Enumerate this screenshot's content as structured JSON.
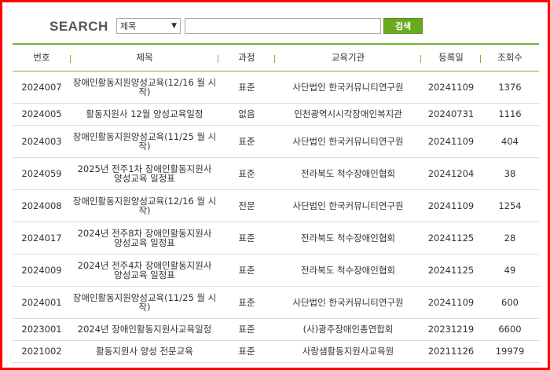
{
  "search": {
    "title": "SEARCH",
    "select_value": "제목",
    "input_value": "",
    "button_label": "검색"
  },
  "table": {
    "headers": [
      "번호",
      "제목",
      "과정",
      "교육기관",
      "등록일",
      "조회수"
    ],
    "rows": [
      {
        "no": "2024007",
        "title": "장애인활동지원양성교육(12/16 월 시작)",
        "course": "표준",
        "org": "사단법인 한국커뮤니티연구원",
        "date": "20241109",
        "views": "1376"
      },
      {
        "no": "2024005",
        "title": "활동지원사 12월 양성교육일정",
        "course": "없음",
        "org": "인천광역시시각장애인복지관",
        "date": "20240731",
        "views": "1116"
      },
      {
        "no": "2024003",
        "title": "장애인활동지원양성교육(11/25 월 시작)",
        "course": "표준",
        "org": "사단법인 한국커뮤니티연구원",
        "date": "20241109",
        "views": "404"
      },
      {
        "no": "2024059",
        "title": "2025년 전주1차 장애인활동지원사 양성교육 일정표",
        "course": "표준",
        "org": "전라북도 척수장애인협회",
        "date": "20241204",
        "views": "38"
      },
      {
        "no": "2024008",
        "title": "장애인활동지원양성교육(12/16 월 시작)",
        "course": "전문",
        "org": "사단법인 한국커뮤니티연구원",
        "date": "20241109",
        "views": "1254"
      },
      {
        "no": "2024017",
        "title": "2024년 전주8차 장애인활동지원사 양성교육 일정표",
        "course": "표준",
        "org": "전라북도 척수장애인협회",
        "date": "20241125",
        "views": "28"
      },
      {
        "no": "2024009",
        "title": "2024년 전주4차 장애인활동지원사 양성교육 일정표",
        "course": "표준",
        "org": "전라북도 척수장애인협회",
        "date": "20241125",
        "views": "49"
      },
      {
        "no": "2024001",
        "title": "장애인활동지원양성교육(11/25 월 시작)",
        "course": "표준",
        "org": "사단법인 한국커뮤니티연구원",
        "date": "20241109",
        "views": "600"
      },
      {
        "no": "2023001",
        "title": "2024년 장애인활동지원사교육일정",
        "course": "표준",
        "org": "(사)광주장애인총연합회",
        "date": "20231219",
        "views": "6600"
      },
      {
        "no": "2021002",
        "title": "활동지원사 양성 전문교육",
        "course": "표준",
        "org": "사랑샘활동지원사교육원",
        "date": "20211126",
        "views": "19979"
      }
    ]
  },
  "colors": {
    "frame_border": "#ff0000",
    "accent_green": "#7bb33a",
    "button_green": "#6aaa1e"
  }
}
